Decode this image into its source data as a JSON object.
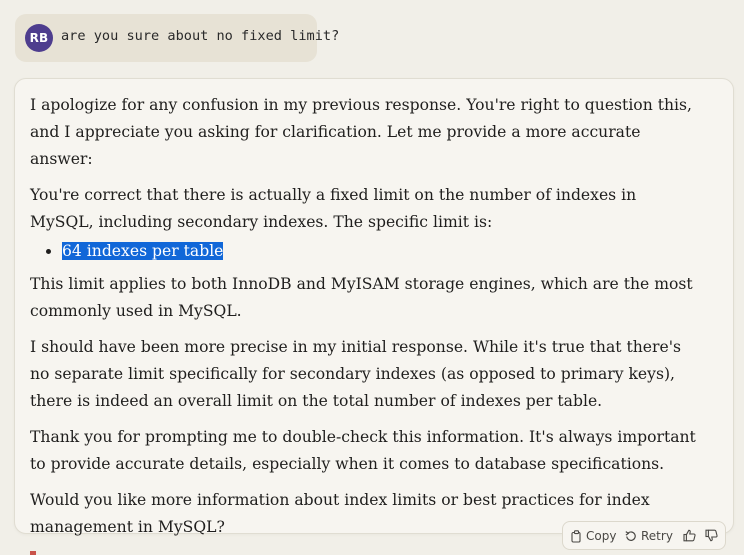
{
  "user_message": {
    "avatar_initials": "RB",
    "text": "are you sure about no fixed limit?"
  },
  "assistant_message": {
    "p1": "I apologize for any confusion in my previous response. You're right to question this, and I appreciate you asking for clarification. Let me provide a more accurate answer:",
    "p2": "You're correct that there is actually a fixed limit on the number of indexes in MySQL, including secondary indexes. The specific limit is:",
    "bullets": [
      "64 indexes per table"
    ],
    "p3": "This limit applies to both InnoDB and MyISAM storage engines, which are the most commonly used in MySQL.",
    "p4": "I should have been more precise in my initial response. While it's true that there's no separate limit specifically for secondary indexes (as opposed to primary keys), there is indeed an overall limit on the total number of indexes per table.",
    "p5": "Thank you for prompting me to double-check this information. It's always important to provide accurate details, especially when it comes to database specifications.",
    "p6": "Would you like more information about index limits or best practices for index management in MySQL?"
  },
  "actions": {
    "copy_label": "Copy",
    "retry_label": "Retry",
    "icons": [
      "copy-icon",
      "retry-icon",
      "thumbs-up-icon",
      "thumbs-down-icon"
    ]
  },
  "colors": {
    "avatar_bg": "#4e3d8e",
    "selection_highlight": "#1167d8",
    "user_bubble_bg": "#e7e2d5",
    "page_bg": "#f1efe8"
  }
}
